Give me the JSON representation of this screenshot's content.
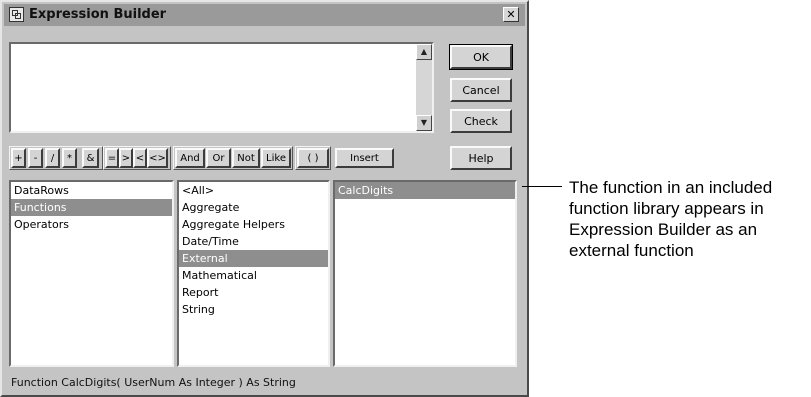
{
  "window": {
    "title": "Expression Builder",
    "close_glyph": "✕"
  },
  "buttons": {
    "ok": "OK",
    "cancel": "Cancel",
    "check": "Check",
    "help": "Help",
    "insert": "Insert"
  },
  "operators": [
    "+",
    "-",
    "/",
    "*",
    "&",
    "=",
    ">",
    "<",
    "<>",
    "And",
    "Or",
    "Not",
    "Like",
    "( )"
  ],
  "expression": {
    "value": ""
  },
  "lists": {
    "categories": [
      "DataRows",
      "Functions",
      "Operators"
    ],
    "categories_selected": 1,
    "subcategories": [
      "<All>",
      "Aggregate",
      "Aggregate Helpers",
      "Date/Time",
      "External",
      "Mathematical",
      "Report",
      "String"
    ],
    "subcategories_selected": 4,
    "functions": [
      "CalcDigits"
    ],
    "functions_selected": 0
  },
  "status": {
    "signature": "Function CalcDigits( UserNum As Integer ) As String"
  },
  "annotation": {
    "text": "The function in an included function library appears in Expression Builder as an external function"
  },
  "icons": {
    "app": "expression-builder-icon",
    "close": "close-icon",
    "scroll_up": "scroll-up-arrow-icon",
    "scroll_down": "scroll-down-arrow-icon"
  }
}
